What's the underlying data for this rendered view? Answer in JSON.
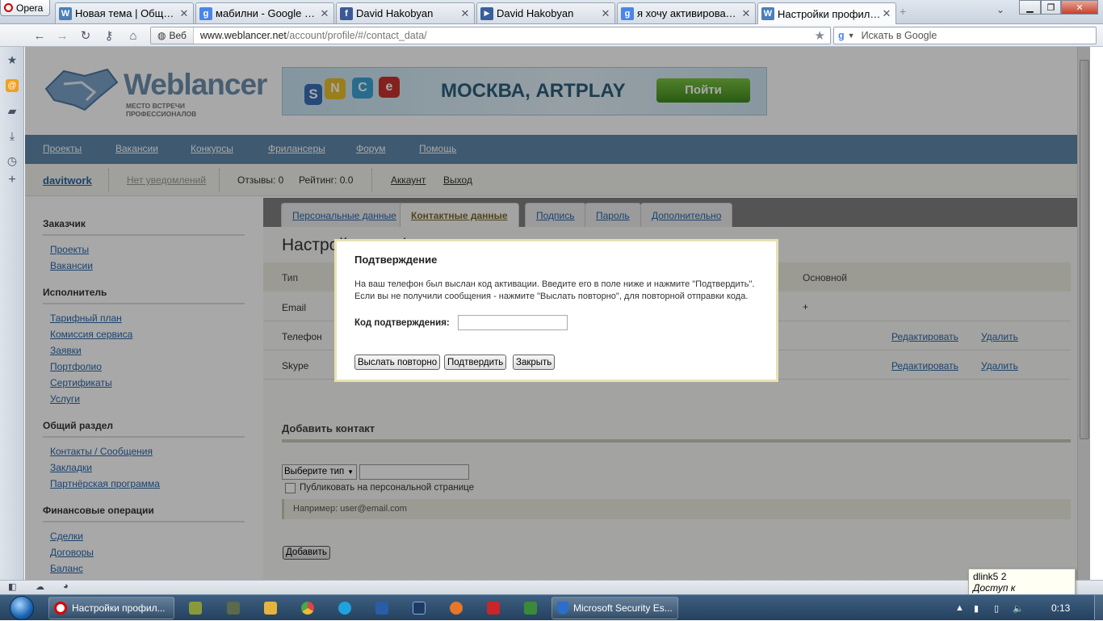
{
  "browser": {
    "opera_label": "Opera",
    "tabs": [
      {
        "title": "Новая тема | Общени...",
        "icon": "W"
      },
      {
        "title": "мабилни - Google Sea...",
        "icon": "g"
      },
      {
        "title": "David Hakobyan",
        "icon": "f"
      },
      {
        "title": "David Hakobyan",
        "icon": "▶"
      },
      {
        "title": "я хочу активировать с...",
        "icon": "g"
      },
      {
        "title": "Настройки профиля | ...",
        "icon": "W"
      }
    ],
    "web_label": "Веб",
    "url_domain": "www.weblancer.net",
    "url_path": "/account/profile/#/contact_data/",
    "search_placeholder": "Искать в Google"
  },
  "site": {
    "logo_text": "Weblancer",
    "logo_tagline": "МЕСТО ВСТРЕЧИ ПРОФЕССИОНАЛОВ",
    "banner_text": "МОСКВА, ARTPLAY",
    "banner_button": "Пойти",
    "banner_letters": [
      "S",
      "N",
      "C",
      "e"
    ],
    "nav": [
      "Проекты",
      "Вакансии",
      "Конкурсы",
      "Фрилансеры",
      "Форум",
      "Помощь"
    ],
    "user": {
      "name": "davitwork",
      "notifications": "Нет уведомлений",
      "reviews": "Отзывы: 0",
      "rating": "Рейтинг: 0.0",
      "account": "Аккаунт",
      "logout": "Выход"
    },
    "sidebar": {
      "sections": [
        {
          "title": "Заказчик",
          "links": [
            "Проекты",
            "Вакансии"
          ]
        },
        {
          "title": "Исполнитель",
          "links": [
            "Тарифный план",
            "Комиссия сервиса",
            "Заявки",
            "Портфолио",
            "Сертификаты",
            "Услуги"
          ]
        },
        {
          "title": "Общий раздел",
          "links": [
            "Контакты / Сообщения",
            "Закладки",
            "Партнёрская программа"
          ]
        },
        {
          "title": "Финансовые операции",
          "links": [
            "Сделки",
            "Договоры",
            "Баланс"
          ]
        }
      ]
    },
    "profile_tabs": [
      "Персональные данные",
      "Контактные данные",
      "Подпись",
      "Пароль",
      "Дополнительно"
    ],
    "page_heading": "Настройки профиля",
    "contacts_table": {
      "col_type": "Тип",
      "col_main": "Основной",
      "rows": [
        {
          "type": "Email",
          "main": "+",
          "edit": "",
          "delete": ""
        },
        {
          "type": "Телефон",
          "main": "",
          "edit": "Редактировать",
          "delete": "Удалить"
        },
        {
          "type": "Skype",
          "main": "",
          "edit": "Редактировать",
          "delete": "Удалить"
        }
      ]
    },
    "add_contact": {
      "heading": "Добавить контакт",
      "select_value": "Выберите тип",
      "publish_label": "Публиковать на персональной странице",
      "hint": "Например: user@email.com",
      "add_button": "Добавить"
    }
  },
  "modal": {
    "title": "Подтверждение",
    "text_line1": "На ваш телефон был выслан код активации. Введите его в поле ниже и нажмите \"Подтвердить\".",
    "text_line2": "Если вы не получили сообщения - нажмите \"Выслать повторно\", для повторной отправки кода.",
    "code_label": "Код подтверждения:",
    "code_value": "",
    "resend_button": "Выслать повторно",
    "confirm_button": "Подтвердить",
    "close_button": "Закрыть"
  },
  "tooltip": {
    "line1": "dlink5  2",
    "line2": "Доступ к Интернету"
  },
  "taskbar": {
    "items": [
      {
        "label": "Настройки профил...",
        "icon": "opera-icon"
      },
      {
        "label": "Microsoft Security Es...",
        "icon": "security-essentials-icon"
      }
    ],
    "clock": "0:13"
  },
  "colors": {
    "nav_blue": "#5f88aa",
    "link_blue": "#2a66a8",
    "modal_border": "#e8e1b2",
    "active_tab_text": "#7a6a2a"
  }
}
